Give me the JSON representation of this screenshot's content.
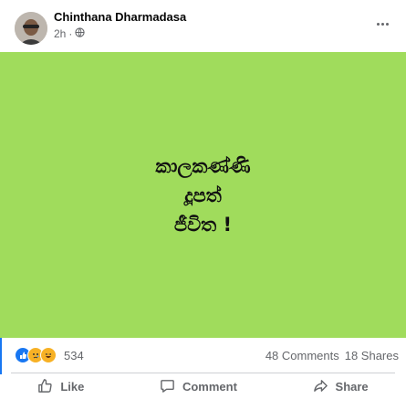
{
  "post": {
    "author": "Chinthana Dharmadasa",
    "time": "2h",
    "privacy_icon": "globe-icon",
    "lines": [
      "කාලකණ්ණි",
      "දූපත්",
      "ජීවිත !"
    ],
    "background_color": "#a0dc5c"
  },
  "stats": {
    "reaction_count": "534",
    "reactions": [
      "like",
      "sad",
      "haha"
    ],
    "comments": "48 Comments",
    "shares": "18 Shares"
  },
  "actions": {
    "like": "Like",
    "comment": "Comment",
    "share": "Share"
  },
  "colors": {
    "accent": "#1877f2",
    "meta_text": "#65676b"
  }
}
